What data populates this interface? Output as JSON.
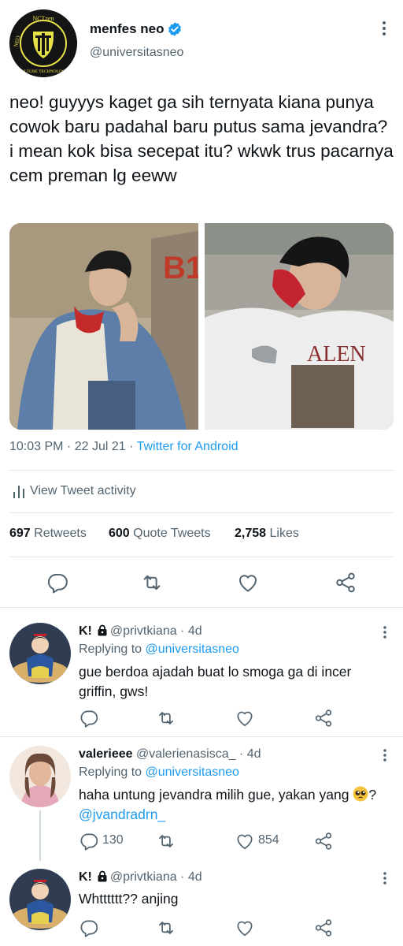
{
  "tweet": {
    "author_name": "menfes neo",
    "author_handle": "@universitasneo",
    "avatar_text": {
      "top": "NCTzen",
      "left": "NEO",
      "bottom": "CULTURE TECHNOLOGY"
    },
    "text": "neo! guyyys kaget ga sih ternyata kiana punya cowok baru padahal baru putus sama jevandra? i mean kok bisa secepat itu? wkwk trus pacarnya cem preman lg eeww",
    "time": "10:03 PM · 22 Jul 21 · ",
    "source": "Twitter for Android",
    "view_activity": "View Tweet activity",
    "stats": {
      "retweets_count": "697",
      "retweets_label": "Retweets",
      "quotes_count": "600",
      "quotes_label": "Quote Tweets",
      "likes_count": "2,758",
      "likes_label": "Likes"
    }
  },
  "replies": [
    {
      "name": "K!",
      "handle_time": "@privtkiana · 4d",
      "replying_prefix": "Replying to ",
      "replying_to": "@universitasneo",
      "text": "gue berdoa ajadah buat lo smoga ga di incer griffin, gws!",
      "reply_count": "",
      "retweet_count": "",
      "like_count": ""
    },
    {
      "name": "valerieee",
      "handle_time": "@valerienasisca_ · 4d",
      "replying_prefix": "Replying to ",
      "replying_to": "@universitasneo",
      "text": "haha untung jevandra milih gue, yakan yang",
      "text_after_emoji": "? ",
      "mention": "@jvandradrn_",
      "reply_count": "130",
      "retweet_count": "",
      "like_count": "854"
    },
    {
      "name": "K!",
      "handle_time": "@privtkiana · 4d",
      "text": "Whtttttt?? anjing",
      "reply_count": "",
      "retweet_count": "",
      "like_count": ""
    }
  ],
  "colors": {
    "text": "#0f1419",
    "secondary": "#536471",
    "link": "#1d9bf0",
    "divider": "#e3e6ea",
    "logo_yellow": "#e8e24a"
  },
  "icons": [
    "verified-icon",
    "more-vert-icon",
    "activity-icon",
    "reply-icon",
    "retweet-icon",
    "like-icon",
    "share-icon",
    "lock-icon",
    "pleading-face-emoji"
  ]
}
